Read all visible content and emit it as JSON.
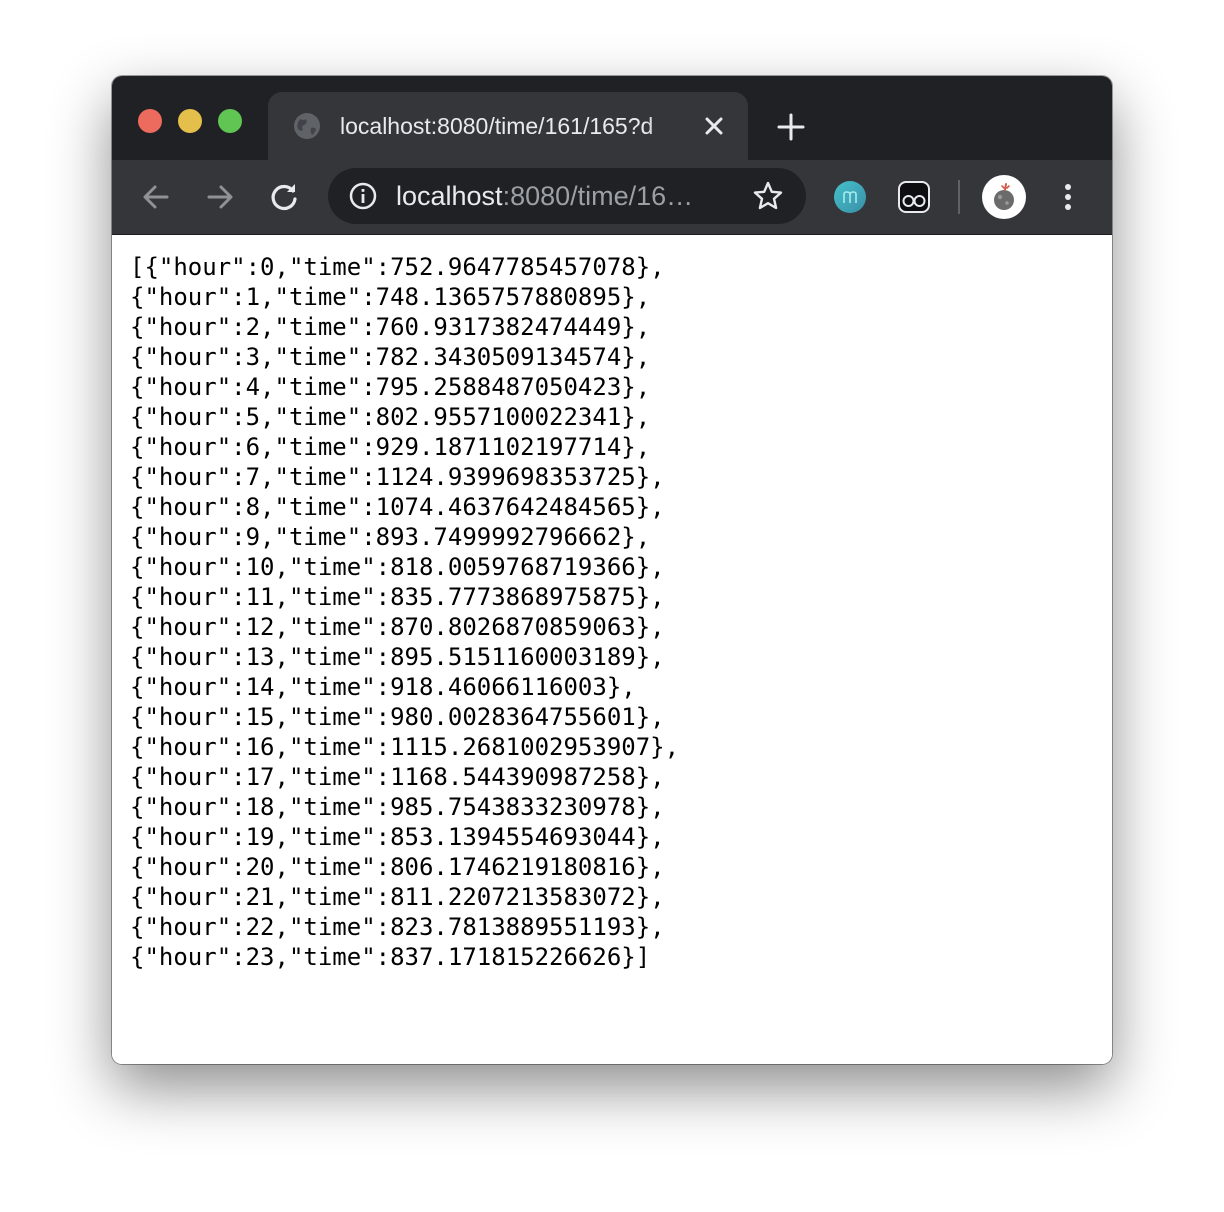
{
  "browser": {
    "tab": {
      "title": "localhost:8080/time/161/165?d",
      "icon": "globe-icon",
      "close_icon": "close-icon"
    },
    "new_tab_icon": "plus-icon",
    "toolbar": {
      "back_icon": "arrow-left-icon",
      "forward_icon": "arrow-right-icon",
      "reload_icon": "reload-icon",
      "address": {
        "host": "localhost",
        "rest": ":8080/time/16…"
      },
      "info_icon": "info-icon",
      "bookmark_icon": "star-icon",
      "extensions": [
        "m-extension-icon",
        "owl-extension-icon"
      ],
      "profile_icon": "avatar",
      "menu_icon": "kebab-menu-icon"
    },
    "colors": {
      "frame": "#202124",
      "toolbar": "#35363a",
      "close": "#ed6a5e",
      "minimize": "#e5bf4b",
      "maximize": "#61c554"
    }
  },
  "page": {
    "lines": [
      "[{\"hour\":0,\"time\":752.9647785457078},",
      "{\"hour\":1,\"time\":748.1365757880895},",
      "{\"hour\":2,\"time\":760.9317382474449},",
      "{\"hour\":3,\"time\":782.3430509134574},",
      "{\"hour\":4,\"time\":795.2588487050423},",
      "{\"hour\":5,\"time\":802.9557100022341},",
      "{\"hour\":6,\"time\":929.1871102197714},",
      "{\"hour\":7,\"time\":1124.9399698353725},",
      "{\"hour\":8,\"time\":1074.4637642484565},",
      "{\"hour\":9,\"time\":893.7499992796662},",
      "{\"hour\":10,\"time\":818.0059768719366},",
      "{\"hour\":11,\"time\":835.7773868975875},",
      "{\"hour\":12,\"time\":870.8026870859063},",
      "{\"hour\":13,\"time\":895.5151160003189},",
      "{\"hour\":14,\"time\":918.46066116003},",
      "{\"hour\":15,\"time\":980.0028364755601},",
      "{\"hour\":16,\"time\":1115.2681002953907},",
      "{\"hour\":17,\"time\":1168.544390987258},",
      "{\"hour\":18,\"time\":985.7543833230978},",
      "{\"hour\":19,\"time\":853.1394554693044},",
      "{\"hour\":20,\"time\":806.1746219180816},",
      "{\"hour\":21,\"time\":811.2207213583072},",
      "{\"hour\":22,\"time\":823.7813889551193},",
      "{\"hour\":23,\"time\":837.171815226626}]"
    ]
  }
}
